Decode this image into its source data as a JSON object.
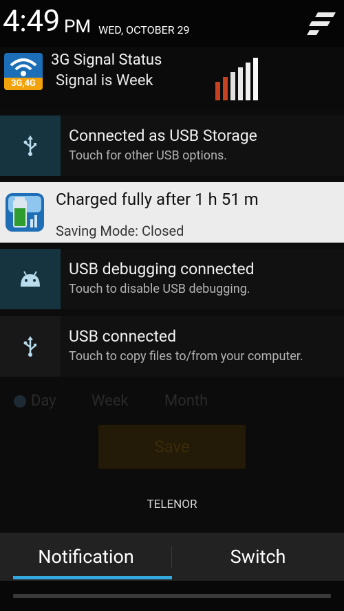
{
  "status": {
    "time": "4:49",
    "ampm": "PM",
    "date": "WED, OCTOBER 29"
  },
  "notifications": [
    {
      "title": "3G Signal Status",
      "subtitle": "Signal is Week",
      "app_badge": "3G,4G"
    },
    {
      "title": "Connected as USB Storage",
      "subtitle": "Touch for other USB options."
    },
    {
      "title": "Charged fully after 1 h 51 m",
      "subtitle": "Saving Mode: Closed"
    },
    {
      "title": "USB debugging connected",
      "subtitle": "Touch to disable USB debugging."
    },
    {
      "title": "USB connected",
      "subtitle": "Touch to copy files to/from your computer."
    }
  ],
  "background_app": {
    "labels": [
      "Day",
      "Week",
      "Month"
    ],
    "save_label": "Save"
  },
  "carrier": "TELENOR",
  "tabs": [
    "Notification",
    "Switch"
  ],
  "colors": {
    "accent": "#33a8dd",
    "usb_icon_bg": "#16343f",
    "signal_bar_red": "#c7401f"
  }
}
